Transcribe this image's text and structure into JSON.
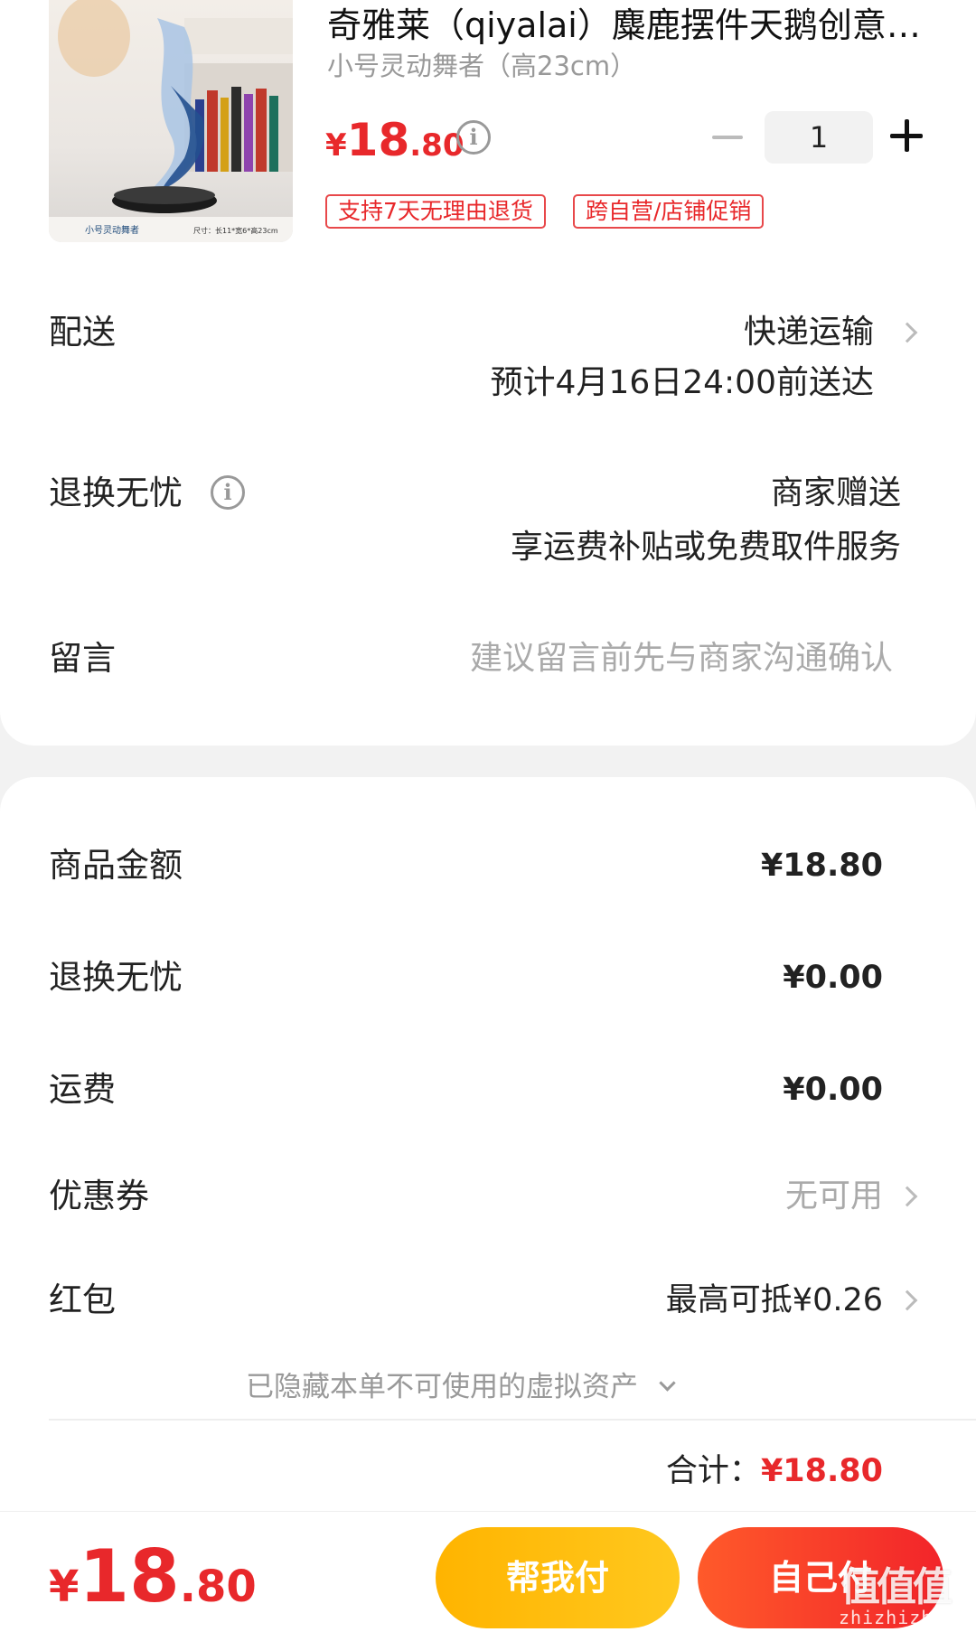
{
  "product": {
    "title": "奇雅莱（qiyalai）麋鹿摆件天鹅创意…",
    "sku": "小号灵动舞者（高23cm）",
    "price_currency": "¥",
    "price_int": "18",
    "price_dec": ".80",
    "quantity": "1",
    "tags": [
      "支持7天无理由退货",
      "跨自营/店铺促销"
    ],
    "image_caption_left": "小号灵动舞者",
    "image_caption_right": "尺寸：长11*宽6*高23cm"
  },
  "delivery": {
    "label": "配送",
    "method": "快递运输",
    "eta": "预计4月16日24:00前送达"
  },
  "return_service": {
    "label": "退换无忧",
    "value": "商家赠送",
    "detail": "享运费补贴或免费取件服务"
  },
  "message": {
    "label": "留言",
    "placeholder": "建议留言前先与商家沟通确认"
  },
  "summary": {
    "goods_label": "商品金额",
    "goods_value": "¥18.80",
    "return_label": "退换无忧",
    "return_value": "¥0.00",
    "shipping_label": "运费",
    "shipping_value": "¥0.00",
    "coupon_label": "优惠券",
    "coupon_value": "无可用",
    "redpacket_label": "红包",
    "redpacket_value": "最高可抵¥0.26",
    "hidden_assets": "已隐藏本单不可使用的虚拟资产",
    "total_label": "合计：",
    "total_value": "¥18.80"
  },
  "footer": {
    "price_currency": "¥",
    "price_int": "18",
    "price_dec": ".80",
    "help_pay": "帮我付",
    "self_pay": "自己付",
    "watermark": "值值值",
    "watermark_url": "zhizhizhi.com"
  },
  "colors": {
    "accent_red": "#e8282b",
    "help_button": "#ffb400",
    "pay_button": "#f2242a"
  }
}
